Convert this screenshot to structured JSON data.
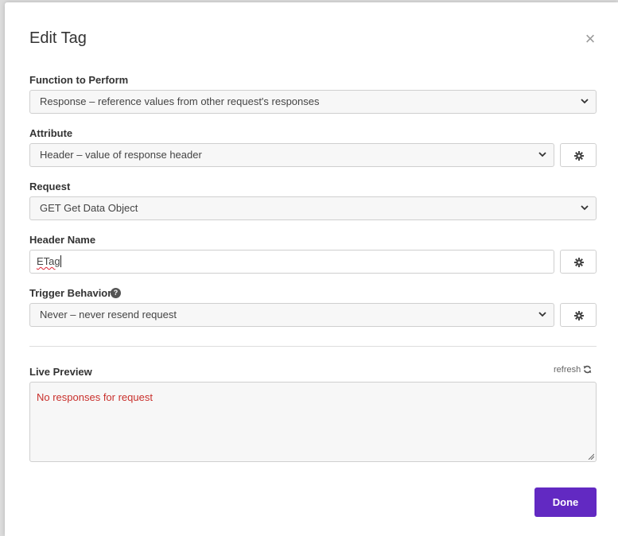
{
  "dialog": {
    "title": "Edit Tag",
    "close_symbol": "×"
  },
  "fields": {
    "function": {
      "label": "Function to Perform",
      "value": "Response – reference values from other request's responses"
    },
    "attribute": {
      "label": "Attribute",
      "value": "Header – value of response header"
    },
    "request": {
      "label": "Request",
      "value": "GET Get Data Object"
    },
    "header_name": {
      "label": "Header Name",
      "value": "ETag"
    },
    "trigger": {
      "label": "Trigger Behavior",
      "value": "Never – never resend request",
      "help_symbol": "?"
    }
  },
  "preview": {
    "label": "Live Preview",
    "refresh_label": "refresh",
    "message": "No responses for request"
  },
  "actions": {
    "done_label": "Done"
  },
  "icons": {
    "close": "close-icon",
    "chevron": "chevron-down-icon",
    "gear": "gear-icon",
    "refresh": "refresh-icon",
    "help": "help-icon"
  },
  "colors": {
    "accent": "#6229c2",
    "error_text": "#c9302c"
  }
}
